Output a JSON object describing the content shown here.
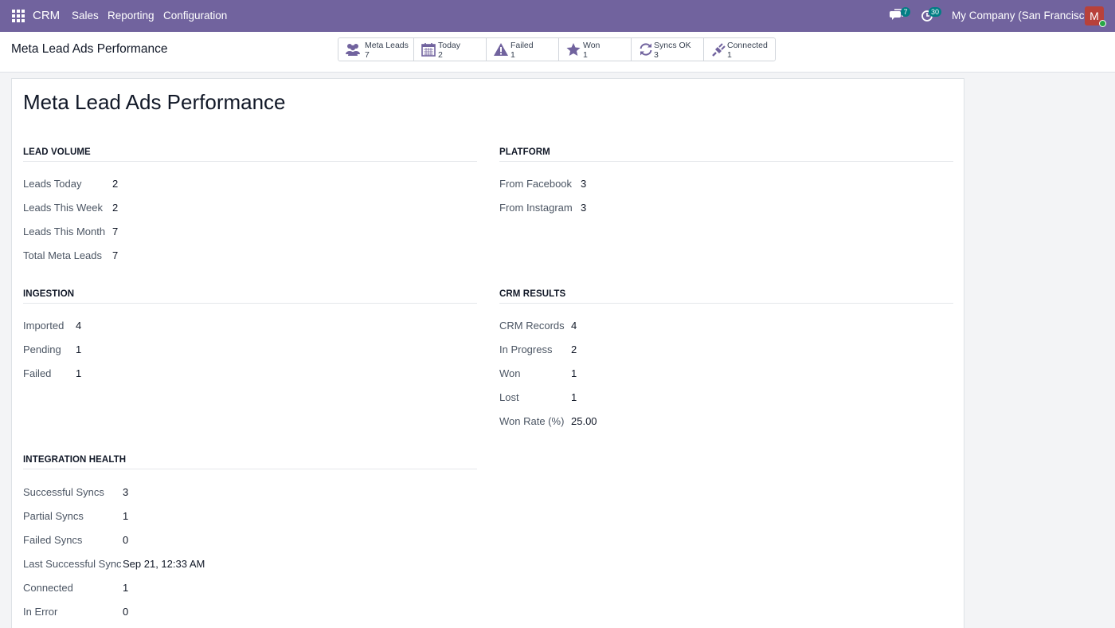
{
  "navbar": {
    "app_name": "CRM",
    "menu": [
      "Sales",
      "Reporting",
      "Configuration"
    ],
    "messages_count": "7",
    "activities_count": "30",
    "company": "My Company (San Francisco)",
    "avatar_letter": "M",
    "accent_color": "#71639e"
  },
  "control_panel": {
    "title": "Meta Lead Ads Performance",
    "stats": [
      {
        "label": "Meta Leads",
        "value": "7",
        "icon": "users-icon"
      },
      {
        "label": "Today",
        "value": "2",
        "icon": "calendar-icon"
      },
      {
        "label": "Failed",
        "value": "1",
        "icon": "warning-icon"
      },
      {
        "label": "Won",
        "value": "1",
        "icon": "star-icon"
      },
      {
        "label": "Syncs OK",
        "value": "3",
        "icon": "refresh-icon"
      },
      {
        "label": "Connected",
        "value": "1",
        "icon": "plug-icon"
      }
    ]
  },
  "sheet": {
    "title": "Meta Lead Ads Performance",
    "lead_volume": {
      "title": "LEAD VOLUME",
      "rows": [
        {
          "label": "Leads Today",
          "value": "2"
        },
        {
          "label": "Leads This Week",
          "value": "2"
        },
        {
          "label": "Leads This Month",
          "value": "7"
        },
        {
          "label": "Total Meta Leads",
          "value": "7"
        }
      ]
    },
    "platform": {
      "title": "PLATFORM",
      "rows": [
        {
          "label": "From Facebook",
          "value": "3"
        },
        {
          "label": "From Instagram",
          "value": "3"
        }
      ]
    },
    "ingestion": {
      "title": "INGESTION",
      "rows": [
        {
          "label": "Imported",
          "value": "4"
        },
        {
          "label": "Pending",
          "value": "1"
        },
        {
          "label": "Failed",
          "value": "1"
        }
      ]
    },
    "crm_results": {
      "title": "CRM RESULTS",
      "rows": [
        {
          "label": "CRM Records",
          "value": "4"
        },
        {
          "label": "In Progress",
          "value": "2"
        },
        {
          "label": "Won",
          "value": "1"
        },
        {
          "label": "Lost",
          "value": "1"
        },
        {
          "label": "Won Rate (%)",
          "value": "25.00"
        }
      ]
    },
    "integration_health": {
      "title": "INTEGRATION HEALTH",
      "rows": [
        {
          "label": "Successful Syncs",
          "value": "3"
        },
        {
          "label": "Partial Syncs",
          "value": "1"
        },
        {
          "label": "Failed Syncs",
          "value": "0"
        },
        {
          "label": "Last Successful Sync",
          "value": "Sep 21, 12:33 AM"
        },
        {
          "label": "Connected",
          "value": "1"
        },
        {
          "label": "In Error",
          "value": "0"
        }
      ]
    }
  }
}
